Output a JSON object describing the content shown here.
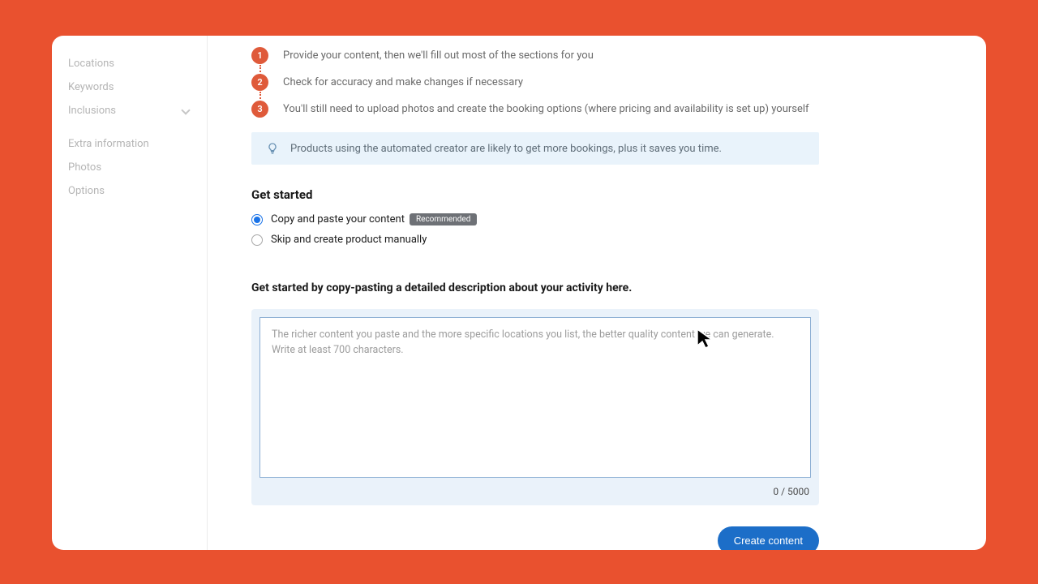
{
  "sidebar": {
    "items": [
      {
        "label": "Locations"
      },
      {
        "label": "Keywords"
      },
      {
        "label": "Inclusions"
      },
      {
        "label": "Extra information"
      },
      {
        "label": "Photos"
      },
      {
        "label": "Options"
      }
    ]
  },
  "steps": {
    "items": [
      {
        "num": "1",
        "text": "Provide your content, then we'll fill out most of the sections for you"
      },
      {
        "num": "2",
        "text": "Check for accuracy and make changes if necessary"
      },
      {
        "num": "3",
        "text": "You'll still need to upload photos and create the booking options (where pricing and availability is set up) yourself"
      }
    ]
  },
  "tip": {
    "text": "Products using the automated creator are likely to get more bookings, plus it saves you time."
  },
  "getStarted": {
    "heading": "Get started",
    "options": {
      "copy": {
        "label": "Copy and paste your content",
        "badge": "Recommended"
      },
      "skip": {
        "label": "Skip and create product manually"
      }
    }
  },
  "editor": {
    "heading": "Get started by copy-pasting a detailed description about your activity here.",
    "placeholder": "The richer content you paste and the more specific locations you list, the better quality content we can generate. Write at least 700 characters.",
    "counter": "0 / 5000"
  },
  "actions": {
    "create": "Create content"
  }
}
